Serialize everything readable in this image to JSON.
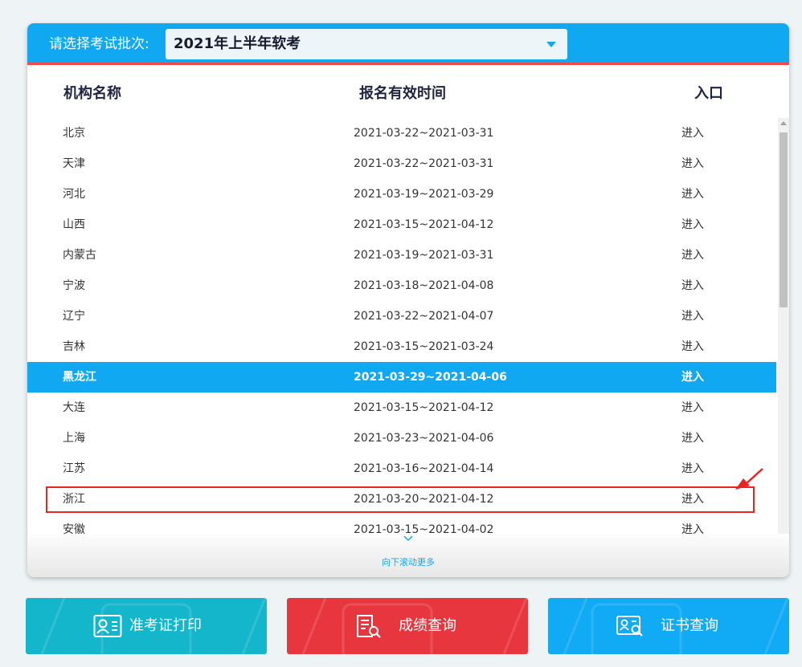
{
  "header": {
    "label": "请选择考试批次:",
    "batch": "2021年上半年软考"
  },
  "columns": {
    "org": "机构名称",
    "time": "报名有效时间",
    "entry": "入口"
  },
  "rows": [
    {
      "org": "北京",
      "time": "2021-03-22~2021-03-31",
      "entry": "进入"
    },
    {
      "org": "天津",
      "time": "2021-03-22~2021-03-31",
      "entry": "进入"
    },
    {
      "org": "河北",
      "time": "2021-03-19~2021-03-29",
      "entry": "进入"
    },
    {
      "org": "山西",
      "time": "2021-03-15~2021-04-12",
      "entry": "进入"
    },
    {
      "org": "内蒙古",
      "time": "2021-03-19~2021-03-31",
      "entry": "进入"
    },
    {
      "org": "宁波",
      "time": "2021-03-18~2021-04-08",
      "entry": "进入"
    },
    {
      "org": "辽宁",
      "time": "2021-03-22~2021-04-07",
      "entry": "进入"
    },
    {
      "org": "吉林",
      "time": "2021-03-15~2021-03-24",
      "entry": "进入"
    },
    {
      "org": "黑龙江",
      "time": "2021-03-29~2021-04-06",
      "entry": "进入"
    },
    {
      "org": "大连",
      "time": "2021-03-15~2021-04-12",
      "entry": "进入"
    },
    {
      "org": "上海",
      "time": "2021-03-23~2021-04-06",
      "entry": "进入"
    },
    {
      "org": "江苏",
      "time": "2021-03-16~2021-04-14",
      "entry": "进入"
    },
    {
      "org": "浙江",
      "time": "2021-03-20~2021-04-12",
      "entry": "进入"
    },
    {
      "org": "安徽",
      "time": "2021-03-15~2021-04-02",
      "entry": "进入"
    }
  ],
  "scroll_more": "向下滚动更多",
  "buttons": {
    "admission": "准考证打印",
    "score": "成绩查询",
    "certificate": "证书查询"
  },
  "colors": {
    "accent": "#10a8f0",
    "header_border": "#f04a4a",
    "highlight": "#e82424",
    "btn_admission": "#14b6cc",
    "btn_score": "#e8363f",
    "btn_certificate": "#11aaf5"
  },
  "icons": {
    "admission": "id-card-icon",
    "score": "document-search-icon",
    "certificate": "certificate-search-icon"
  }
}
